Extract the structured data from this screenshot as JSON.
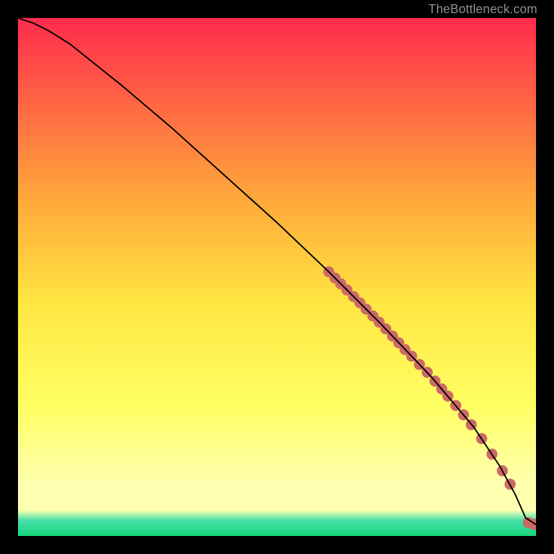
{
  "attribution": "TheBottleneck.com",
  "colors": {
    "top": "#ff2b4d",
    "mid_upper": "#ffa83a",
    "mid": "#ffe642",
    "mid_lower": "#ffff63",
    "pale": "#ffffb0",
    "teal": "#46e0a8",
    "green": "#16d57a",
    "curve": "#000000",
    "marker": "#cc6a66"
  },
  "chart_data": {
    "type": "line",
    "title": "",
    "xlabel": "",
    "ylabel": "",
    "xlim": [
      0,
      100
    ],
    "ylim": [
      0,
      100
    ],
    "curve": {
      "x": [
        0,
        3,
        6,
        10,
        20,
        30,
        40,
        50,
        60,
        70,
        80,
        88,
        93,
        96,
        98,
        100
      ],
      "y": [
        100,
        99,
        97.5,
        95,
        87,
        78.5,
        69.5,
        60.5,
        51,
        41,
        30.5,
        21,
        13.5,
        8,
        3.5,
        2.2
      ]
    },
    "markers": [
      {
        "x": 60.0,
        "y": 51.0
      },
      {
        "x": 61.2,
        "y": 49.8
      },
      {
        "x": 62.3,
        "y": 48.7
      },
      {
        "x": 63.5,
        "y": 47.5
      },
      {
        "x": 64.8,
        "y": 46.2
      },
      {
        "x": 66.0,
        "y": 45.0
      },
      {
        "x": 67.2,
        "y": 43.8
      },
      {
        "x": 68.5,
        "y": 42.5
      },
      {
        "x": 69.7,
        "y": 41.3
      },
      {
        "x": 71.0,
        "y": 40.0
      },
      {
        "x": 72.3,
        "y": 38.6
      },
      {
        "x": 73.5,
        "y": 37.3
      },
      {
        "x": 74.7,
        "y": 36.0
      },
      {
        "x": 76.0,
        "y": 34.7
      },
      {
        "x": 77.5,
        "y": 33.1
      },
      {
        "x": 79.0,
        "y": 31.6
      },
      {
        "x": 80.5,
        "y": 29.9
      },
      {
        "x": 81.8,
        "y": 28.4
      },
      {
        "x": 83.0,
        "y": 27.0
      },
      {
        "x": 84.5,
        "y": 25.2
      },
      {
        "x": 86.0,
        "y": 23.4
      },
      {
        "x": 87.5,
        "y": 21.5
      },
      {
        "x": 89.5,
        "y": 18.8
      },
      {
        "x": 91.5,
        "y": 15.8
      },
      {
        "x": 93.5,
        "y": 12.6
      },
      {
        "x": 95.0,
        "y": 10.0
      },
      {
        "x": 98.5,
        "y": 2.6
      },
      {
        "x": 99.5,
        "y": 2.3
      },
      {
        "x": 100.0,
        "y": 2.2
      }
    ]
  }
}
